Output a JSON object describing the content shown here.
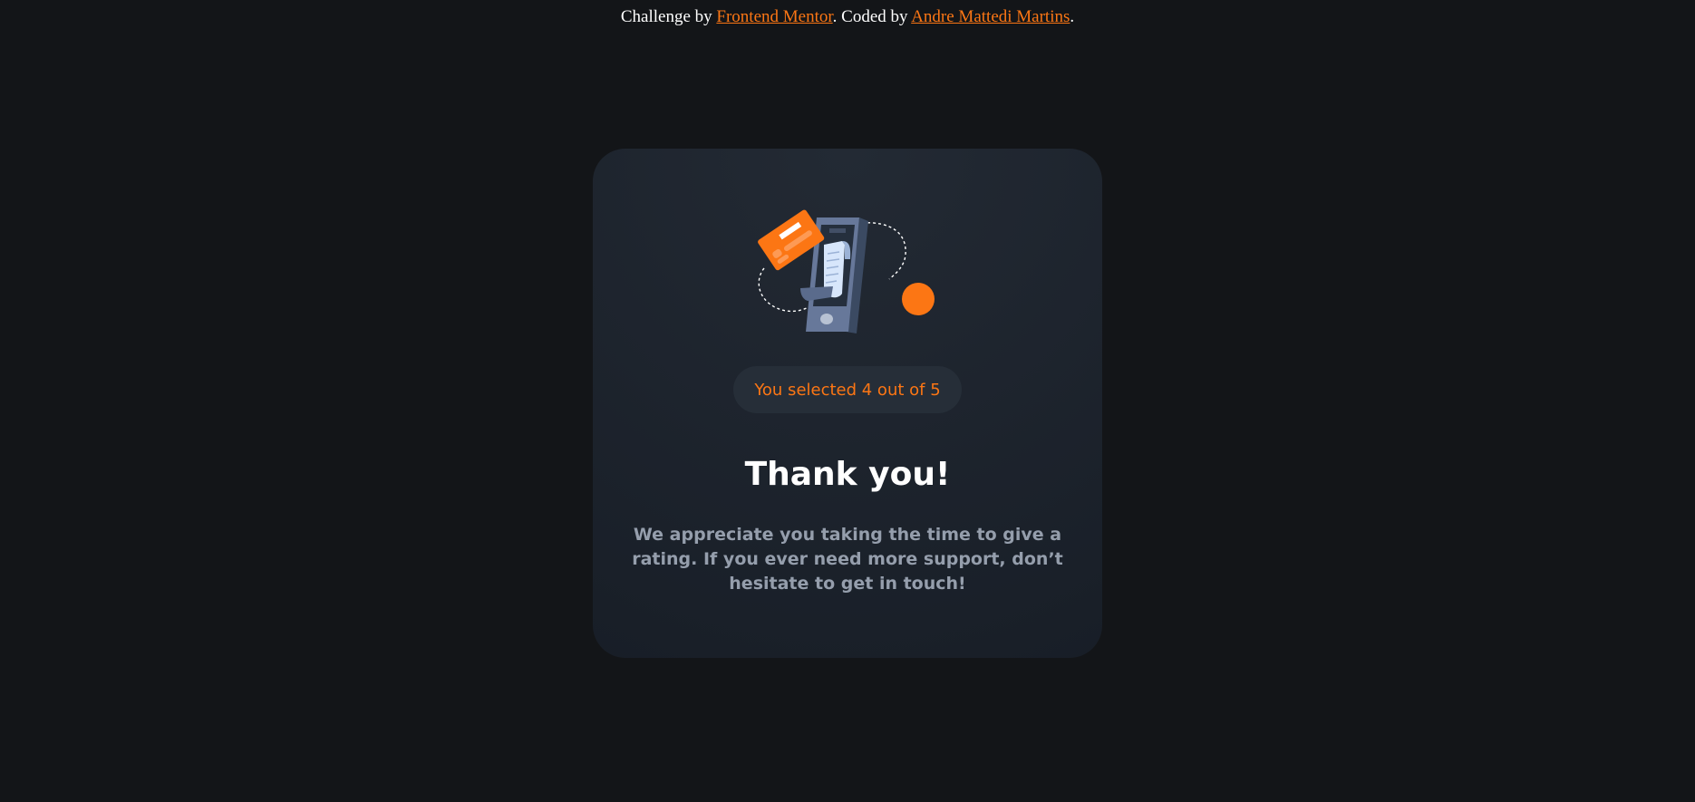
{
  "attribution": {
    "prefix": "Challenge by ",
    "challenge_link": "Frontend Mentor",
    "middle": ". Coded by ",
    "author_link": "Andre Mattedi Martins",
    "suffix": "."
  },
  "card": {
    "illustration_icon": "payment-phone-illustration-icon",
    "selection_badge": "You selected 4 out of 5",
    "rating_selected": 4,
    "rating_max": 5,
    "title": "Thank you!",
    "message": "We appreciate you taking the time to give a rating. If you ever need more support, don’t hesitate to get in touch!"
  },
  "colors": {
    "background": "#131518",
    "card": "#1e252f",
    "accent": "#fc7614",
    "badge_bg": "#262e38",
    "text_light": "#ffffff",
    "text_muted": "#959eac"
  }
}
